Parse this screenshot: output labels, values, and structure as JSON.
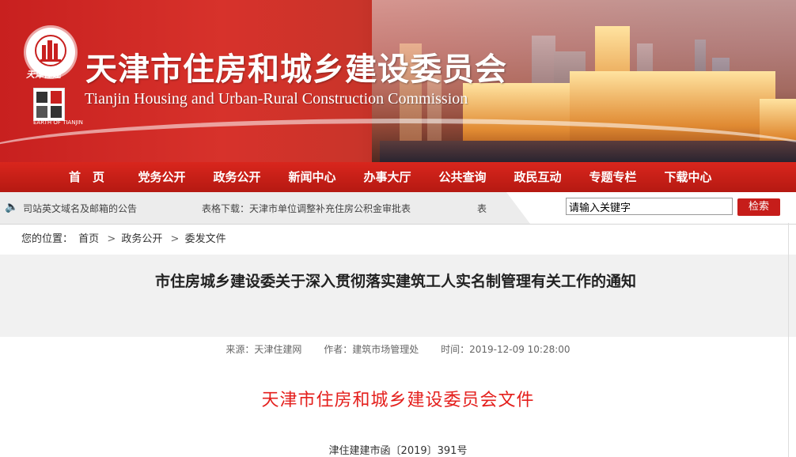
{
  "header": {
    "title": "天津市住房和城乡建设委员会",
    "subtitle": "Tianjin Housing and Urban-Rural Construction Commission",
    "emblem_caption": "天津住建",
    "seal_caption": "EARTH OF TIANJIN",
    "brand_color": "#c8201f"
  },
  "nav": {
    "items": [
      "首　页",
      "党务公开",
      "政务公开",
      "新闻中心",
      "办事大厅",
      "公共查询",
      "政民互动",
      "专题专栏",
      "下载中心"
    ]
  },
  "notice": {
    "icon": "speaker-icon",
    "items": [
      "司站英文域名及邮箱的公告",
      "表格下载：天津市单位调整补充住房公积金审批表",
      "表"
    ]
  },
  "search": {
    "value": "请输入关键字",
    "button_label": "检索"
  },
  "breadcrumb": {
    "prefix": "您的位置：",
    "items": [
      "首页",
      "政务公开",
      "委发文件"
    ]
  },
  "article": {
    "title": "市住房城乡建设委关于深入贯彻落实建筑工人实名制管理有关工作的通知",
    "source": "来源：天津住建网",
    "author": "作者：建筑市场管理处",
    "time": "时间：2019-12-09 10:28:00",
    "doc_header": "天津市住房和城乡建设委员会文件",
    "doc_number": "津住建建市函〔2019〕391号",
    "doc_header_color": "#e41f1c"
  }
}
